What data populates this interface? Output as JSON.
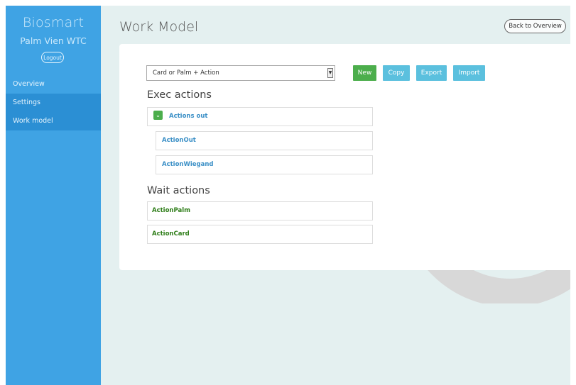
{
  "sidebar": {
    "brand": "Biosmart",
    "site": "Palm Vien WTC",
    "logout_label": "Logout",
    "items": [
      {
        "label": "Overview"
      },
      {
        "label": "Settings"
      },
      {
        "label": "Work model"
      }
    ]
  },
  "header": {
    "title": "Work Model",
    "back_label": "Back to Overview"
  },
  "toolbar": {
    "selected_model": "Card or Palm + Action",
    "new_label": "New",
    "copy_label": "Copy",
    "export_label": "Export",
    "import_label": "Import"
  },
  "exec": {
    "title": "Exec actions",
    "group_label": "Actions out",
    "children": [
      "ActionOut",
      "ActionWiegand"
    ]
  },
  "wait": {
    "title": "Wait actions",
    "items": [
      "ActionPalm",
      "ActionCard"
    ]
  },
  "colors": {
    "sidebar": "#3fa3e4",
    "sidebar_active": "#2b8fd4",
    "background": "#e4f0f0",
    "success": "#4cae4c",
    "info": "#5bc0de",
    "link_blue": "#3a8fc6",
    "link_green": "#2e7d18"
  }
}
